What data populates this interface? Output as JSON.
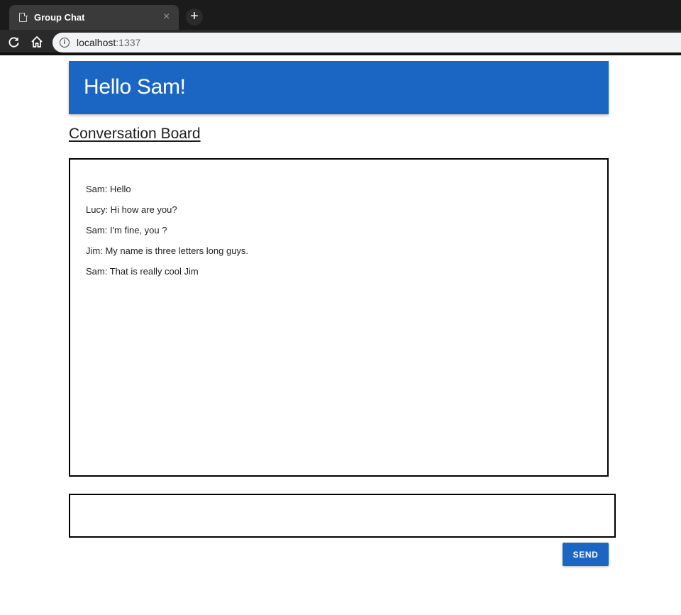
{
  "browser": {
    "tab_title": "Group Chat",
    "close_glyph": "×",
    "new_tab_glyph": "+",
    "url_host": "localhost",
    "url_port": ":1337",
    "info_glyph": "i"
  },
  "header": {
    "title": "Hello Sam!"
  },
  "board": {
    "title": "Conversation Board",
    "messages": [
      "Sam: Hello",
      "Lucy: Hi how are you?",
      "Sam: I'm fine, you ?",
      "Jim: My name is three letters long guys.",
      "Sam: That is really cool Jim"
    ]
  },
  "composer": {
    "value": "",
    "send_label": "SEND"
  },
  "colors": {
    "accent": "#1a66c2",
    "chrome_dark": "#1b1b1b"
  }
}
